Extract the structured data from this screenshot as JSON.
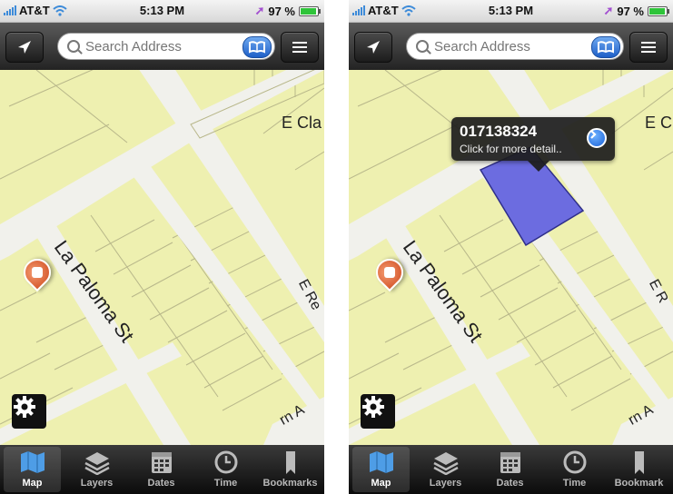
{
  "screens": [
    {
      "status_bar": {
        "carrier": "AT&T",
        "time": "5:13 PM",
        "battery_text": "97 %",
        "battery_level": 0.97
      },
      "search": {
        "placeholder": "Search Address"
      },
      "streets": {
        "la_paloma": "La Paloma St",
        "e_cla": "E Cla",
        "e_re": "E Re",
        "rn_a": "rn A"
      },
      "tabs": [
        {
          "label": "Map"
        },
        {
          "label": "Layers"
        },
        {
          "label": "Dates"
        },
        {
          "label": "Time"
        },
        {
          "label": "Bookmarks"
        }
      ],
      "selected_tab": "Map"
    },
    {
      "status_bar": {
        "carrier": "AT&T",
        "time": "5:13 PM",
        "battery_text": "97 %",
        "battery_level": 0.97
      },
      "search": {
        "placeholder": "Search Address"
      },
      "streets": {
        "la_paloma": "La Paloma St",
        "e_cla": "E Cl",
        "e_re": "E R",
        "rn_a": "rn A"
      },
      "callout": {
        "title": "017138324",
        "subtitle": "Click for more detail.."
      },
      "tabs": [
        {
          "label": "Map"
        },
        {
          "label": "Layers"
        },
        {
          "label": "Dates"
        },
        {
          "label": "Time"
        },
        {
          "label": "Bookmark"
        }
      ],
      "selected_tab": "Map"
    }
  ],
  "colors": {
    "parcel": "#eef0b0",
    "parcel_line": "#b8b78a",
    "road": "#f1f1ec",
    "selected_parcel": "#6c6ce0",
    "pin": "#e0643a",
    "accent_blue": "#2a72e0"
  },
  "icons": [
    "location-arrow-icon",
    "search-icon",
    "address-book-icon",
    "menu-icon",
    "map-pin-icon",
    "settings-gear-icon",
    "map-tab-icon",
    "layers-icon",
    "calendar-icon",
    "clock-icon",
    "bookmark-icon",
    "chevron-right-icon"
  ]
}
